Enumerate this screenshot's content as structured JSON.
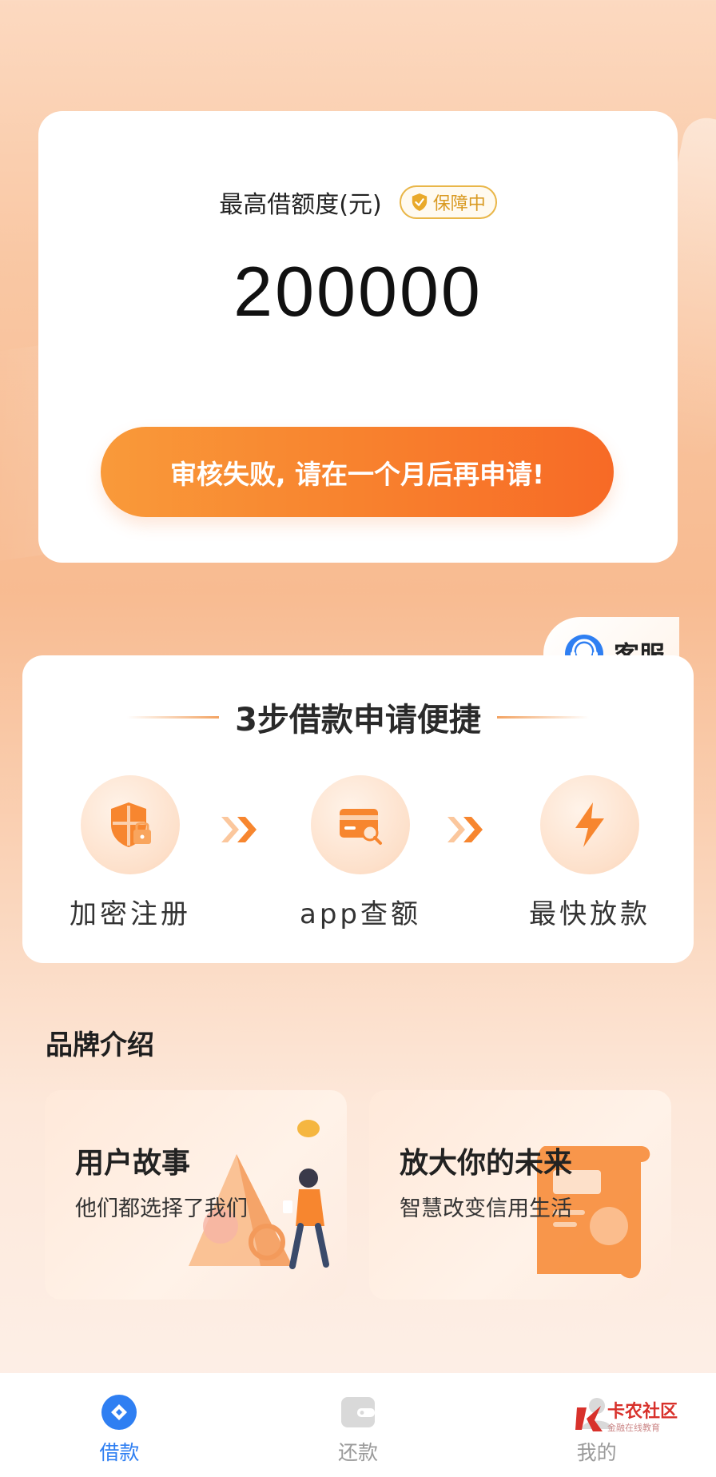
{
  "quota": {
    "title": "最高借额度(元)",
    "badge": "保障中",
    "amount": "200000",
    "button_label": "审核失败, 请在一个月后再申请!"
  },
  "service": {
    "label": "客服"
  },
  "steps": {
    "title": "3步借款申请便捷",
    "items": [
      {
        "label": "加密注册",
        "icon": "shield-lock-icon"
      },
      {
        "label": "app查额",
        "icon": "card-search-icon"
      },
      {
        "label": "最快放款",
        "icon": "lightning-icon"
      }
    ]
  },
  "brand": {
    "title": "品牌介绍",
    "cards": [
      {
        "title": "用户故事",
        "subtitle": "他们都选择了我们"
      },
      {
        "title": "放大你的未来",
        "subtitle": "智慧改变信用生活"
      }
    ]
  },
  "nav": {
    "items": [
      {
        "label": "借款",
        "active": true
      },
      {
        "label": "还款",
        "active": false
      },
      {
        "label": "我的",
        "active": false
      }
    ]
  },
  "watermark": {
    "text": "卡农社区",
    "sub": "金融在线教育"
  },
  "colors": {
    "accent_orange": "#f8822e",
    "nav_active": "#2f7ff2",
    "badge_gold": "#d99a22"
  }
}
